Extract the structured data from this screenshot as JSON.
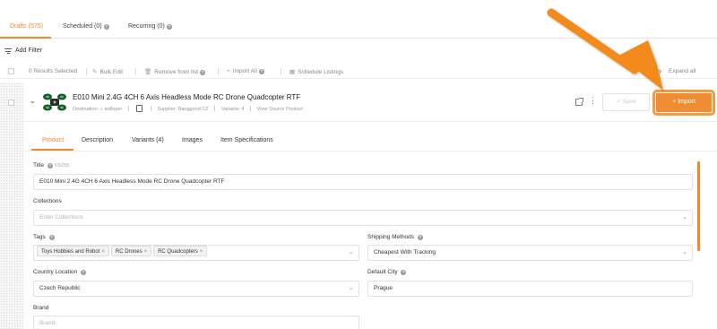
{
  "tabs": [
    {
      "label": "Drafts (575)"
    },
    {
      "label": "Scheduled (0)"
    },
    {
      "label": "Recurring (0)"
    }
  ],
  "filter": {
    "add_filter_label": "Add Filter"
  },
  "actions": {
    "results_selected": "0 Results Selected",
    "bulk_edit": "Bulk Edit",
    "remove_from_list": "Remove from list",
    "import_all": "Import All",
    "schedule_listings": "Schedule Listings",
    "history": "History",
    "expand_all": "Expand all"
  },
  "product": {
    "title": "E010 Mini 2.4G 4CH 6 Axis Headless Mode RC Drone Quadcopter RTF",
    "destination_label": "Destination:",
    "destination_value": "tedloper",
    "supplier": "Supplier: Banggood CZ",
    "variants": "Variants: 4",
    "view_source": "View Source Product",
    "save_label": "Save",
    "import_label": "+ Import"
  },
  "panel_tabs": [
    {
      "label": "Product"
    },
    {
      "label": "Description"
    },
    {
      "label": "Variants (4)"
    },
    {
      "label": "Images"
    },
    {
      "label": "Item Specifications"
    }
  ],
  "form": {
    "title_label": "Title",
    "title_count": "63/255",
    "title_value": "E010 Mini 2.4G 4CH 6 Axis Headless Mode RC Drone Quadcopter RTF",
    "collections_label": "Collections",
    "collections_placeholder": "Enter Collections",
    "tags_label": "Tags",
    "tags": [
      "Toys Hobbies and Robot",
      "RC Drones",
      "RC Quadcopters"
    ],
    "shipping_label": "Shipping Methods",
    "shipping_value": "Cheapest With Tracking",
    "country_label": "Country Location",
    "country_value": "Czech Republic",
    "city_label": "Default City",
    "city_value": "Prague",
    "brand_label": "Brand",
    "brand_placeholder": "Brand"
  },
  "colors": {
    "accent": "#ef8a2a",
    "import_button": "#ef8d35"
  }
}
